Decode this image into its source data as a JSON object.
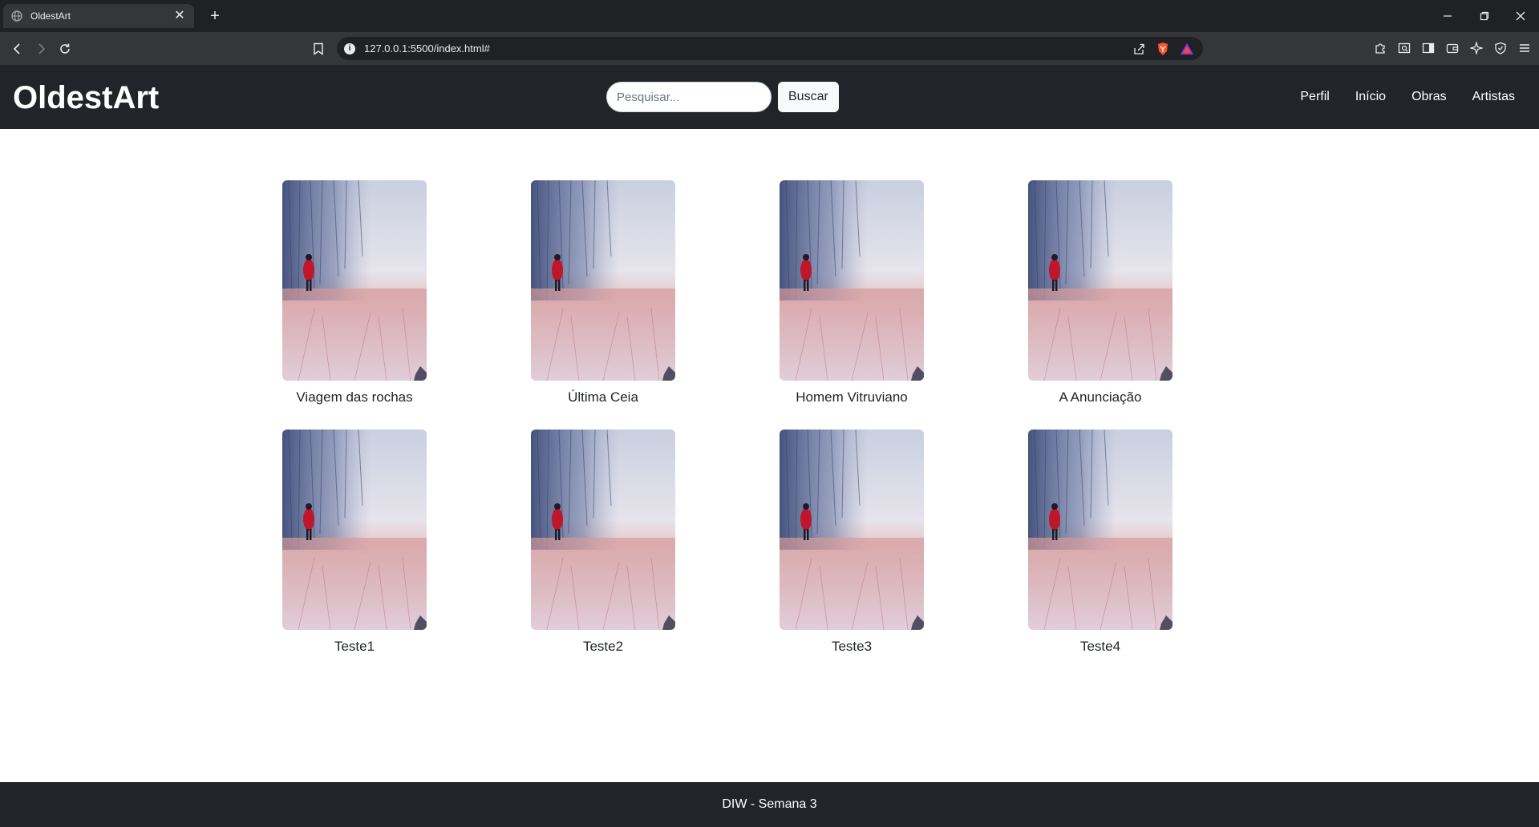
{
  "browser": {
    "tab_title": "OldestArt",
    "tab_close": "✕",
    "new_tab": "+",
    "url": "127.0.0.1:5500/index.html#"
  },
  "header": {
    "logo": "OldestArt",
    "search_placeholder": "Pesquisar...",
    "search_button": "Buscar",
    "nav": [
      "Perfil",
      "Início",
      "Obras",
      "Artistas"
    ]
  },
  "gallery": {
    "items": [
      "Viagem das rochas",
      "Última Ceia",
      "Homem Vitruviano",
      "A Anunciação",
      "Teste1",
      "Teste2",
      "Teste3",
      "Teste4"
    ]
  },
  "footer": {
    "text": "DIW - Semana 3"
  },
  "colors": {
    "header_bg": "#212529",
    "browser_bg": "#202124",
    "toolbar_bg": "#35363a"
  }
}
